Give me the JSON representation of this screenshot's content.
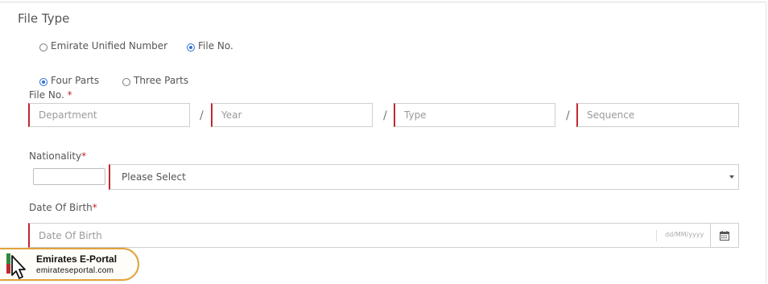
{
  "section": {
    "title": "File Type"
  },
  "file_type_radios": [
    {
      "label": "Emirate Unified Number",
      "checked": false
    },
    {
      "label": "File No.",
      "checked": true
    }
  ],
  "parts_radios": [
    {
      "label": "Four Parts",
      "checked": true
    },
    {
      "label": "Three Parts",
      "checked": false
    }
  ],
  "file_no": {
    "label": "File No.",
    "required_mark": "*",
    "separator": "/",
    "fields": [
      {
        "placeholder": "Department"
      },
      {
        "placeholder": "Year"
      },
      {
        "placeholder": "Type"
      },
      {
        "placeholder": "Sequence"
      }
    ]
  },
  "nationality": {
    "label": "Nationality",
    "required_mark": "*",
    "selected": "Please Select"
  },
  "date_of_birth": {
    "label": "Date Of Birth",
    "required_mark": "*",
    "placeholder": "Date Of Birth",
    "format_hint": "dd/MM/yyyy"
  },
  "watermark": {
    "title": "Emirates E-Portal",
    "subtitle": "emirateseportal.com"
  },
  "colors": {
    "required": "#c0282f",
    "radio_checked": "#2a6fd6",
    "watermark_border": "#e2a23a"
  },
  "icons": {
    "calendar": "calendar-icon",
    "dropdown": "chevron-down-icon"
  }
}
